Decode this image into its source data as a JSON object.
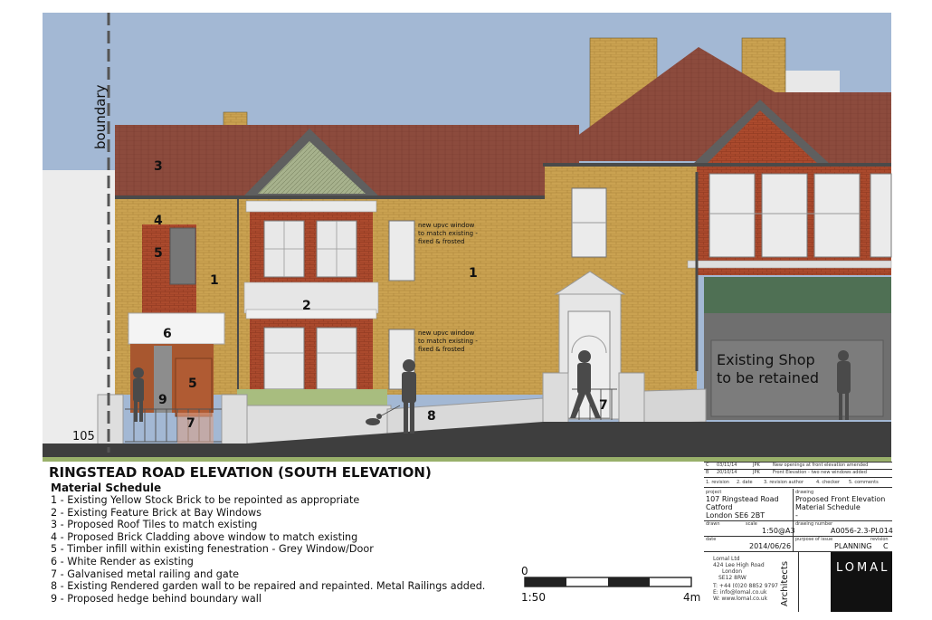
{
  "drawing": {
    "boundary_label": "boundary",
    "ground_level": "105",
    "window_note_upper": [
      "new upvc window",
      "to match existing -",
      "fixed & frosted"
    ],
    "window_note_lower": [
      "new upvc window",
      "to match existing -",
      "fixed & frosted"
    ],
    "shop_label": [
      "Existing Shop",
      "to be retained"
    ],
    "material_tags": [
      "3",
      "4",
      "5",
      "1",
      "1",
      "2",
      "6",
      "9",
      "5",
      "7",
      "8",
      "7"
    ]
  },
  "schedule": {
    "title": "RINGSTEAD ROAD ELEVATION (SOUTH ELEVATION)",
    "heading": "Material Schedule",
    "items": [
      "1 - Existing Yellow Stock Brick to be repointed as appropriate",
      "2 - Existing Feature Brick at Bay Windows",
      "3 - Proposed Roof Tiles to match existing",
      "4 - Proposed Brick Cladding above window to match existing",
      "5 - Timber infill within existing fenestration - Grey Window/Door",
      "6 - White Render as existing",
      "7 - Galvanised metal railing and gate",
      "8 - Existing Rendered garden wall to be repaired and repainted. Metal Railings added.",
      "9 - Proposed hedge behind boundary wall"
    ]
  },
  "scale_bar": {
    "start": "0",
    "ratio": "1:50",
    "end": "4m"
  },
  "title_block": {
    "revisions": [
      {
        "rev": "C",
        "date": "03/11/14",
        "author": "JPK",
        "comment": "New openings at front elevation amended"
      },
      {
        "rev": "B",
        "date": "20/10/14",
        "author": "JPK",
        "comment": "Front Elevation - two new windows added"
      }
    ],
    "revision_headers": [
      "1. revision",
      "2. date",
      "3. revision author",
      "4. checker",
      "5. comments"
    ],
    "project_label": "project",
    "project": [
      "107 Ringstead Road",
      "Catford",
      "London SE6 2BT"
    ],
    "drawing_label": "drawing",
    "drawing": [
      "Proposed Front Elevation",
      "Material Schedule",
      "-"
    ],
    "drawn_label": "drawn",
    "scale_label": "scale",
    "scale": "1:50@A3",
    "date_label": "date",
    "date": "2014/06/26",
    "drawing_number_label": "drawing number",
    "drawing_number": "A0056-2.3-PL014",
    "purpose_label": "purpose of issue",
    "purpose": "PLANNING",
    "revision_label": "revision",
    "revision": "C",
    "company": [
      "Lomal Ltd",
      "424 Lee High Road",
      "London",
      "SE12 8RW"
    ],
    "contact": [
      "T: +44 (0)20 8852 9797",
      "E: info@lomal.co.uk",
      "W: www.lomal.co.uk"
    ],
    "architects_label": "Architects",
    "logo": "LOMAL"
  },
  "colors": {
    "sky": "#a3b8d4",
    "brick": "#c9a04e",
    "red_brick": "#a8452c",
    "roof": "#8a4a3c",
    "ground": "#3e3e3e",
    "grass": "#99b06a",
    "shop_front": "#4f7054"
  }
}
